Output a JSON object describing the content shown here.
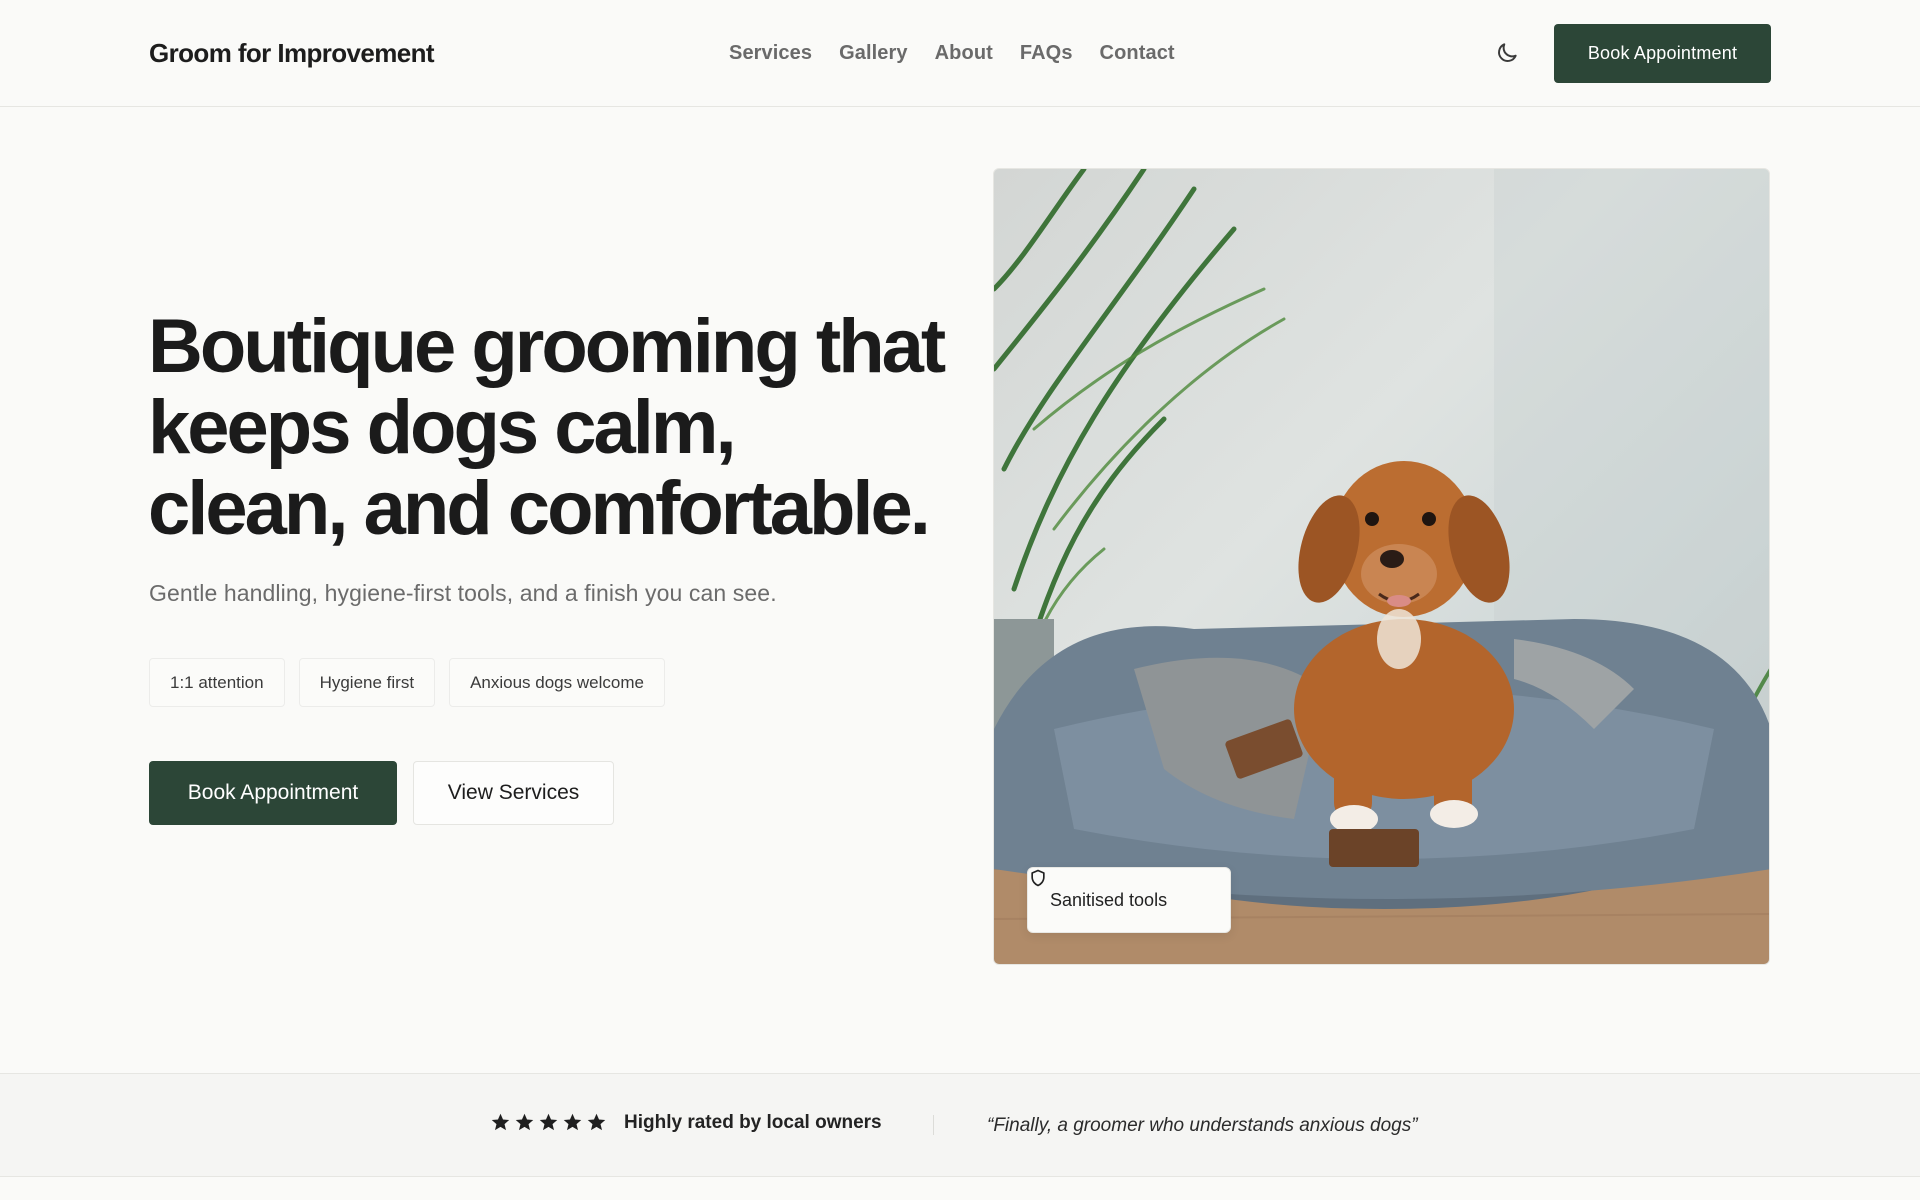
{
  "header": {
    "brand": "Groom for Improvement",
    "nav": [
      "Services",
      "Gallery",
      "About",
      "FAQs",
      "Contact"
    ],
    "theme_icon": "moon-icon",
    "cta_label": "Book Appointment"
  },
  "hero": {
    "headline": "Boutique grooming that keeps dogs calm, clean, and comfortable.",
    "subhead": "Gentle handling, hygiene-first tools, and a finish you can see.",
    "chips": [
      "1:1 attention",
      "Hygiene first",
      "Anxious dogs welcome"
    ],
    "primary_cta": "Book Appointment",
    "secondary_cta": "View Services",
    "image_badge": {
      "icon": "shield-icon",
      "label": "Sanitised tools"
    }
  },
  "rating": {
    "stars": 5,
    "label": "Highly rated by local owners",
    "quote": "“Finally, a groomer who understands anxious dogs”"
  },
  "colors": {
    "accent": "#2c4637",
    "background": "#fafaf8",
    "muted_text": "#6b6b6b"
  }
}
